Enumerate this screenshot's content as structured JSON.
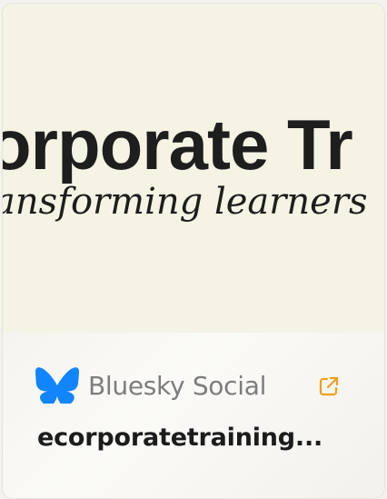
{
  "card": {
    "hero": {
      "line1": "orporate Tr",
      "line2": "ansforming learners"
    },
    "source": {
      "name": "Bluesky Social",
      "icon": "butterfly-icon",
      "brand_color": "#1185fe"
    },
    "external_link": {
      "icon": "external-link-icon",
      "color": "#f0a020"
    },
    "title": "ecorporatetraining..."
  }
}
